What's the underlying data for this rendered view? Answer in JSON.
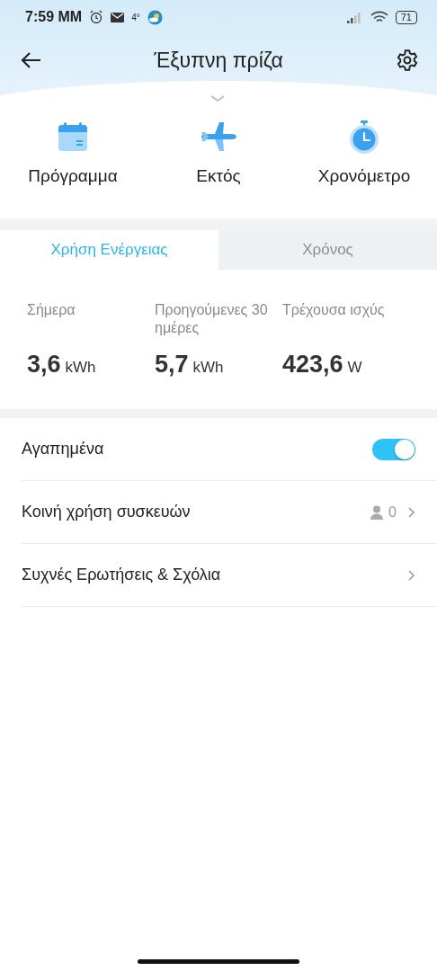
{
  "status_bar": {
    "time": "7:59 MM",
    "temperature": "4°",
    "battery": "71"
  },
  "header": {
    "title": "Έξυπνη πρίζα"
  },
  "actions": [
    {
      "kind": "calendar",
      "label": "Πρόγραμμα"
    },
    {
      "kind": "plane",
      "label": "Εκτός"
    },
    {
      "kind": "timer",
      "label": "Χρονόμετρο"
    }
  ],
  "tabs": [
    {
      "label": "Χρήση Ενέργειας",
      "selected": true
    },
    {
      "label": "Χρόνος",
      "selected": false
    }
  ],
  "stats": [
    {
      "label": "Σήμερα",
      "value": "3,6",
      "unit": "kWh"
    },
    {
      "label": "Προηγούμενες 30 ημέρες",
      "value": "5,7",
      "unit": "kWh"
    },
    {
      "label": "Τρέχουσα ισχύς",
      "value": "423,6",
      "unit": "W"
    }
  ],
  "settings": [
    {
      "kind": "toggle",
      "label": "Αγαπημένα",
      "on": true
    },
    {
      "kind": "count",
      "label": "Κοινή χρήση συσκευών",
      "count": "0"
    },
    {
      "kind": "link",
      "label": "Συχνές Ερωτήσεις & Σχόλια"
    }
  ]
}
